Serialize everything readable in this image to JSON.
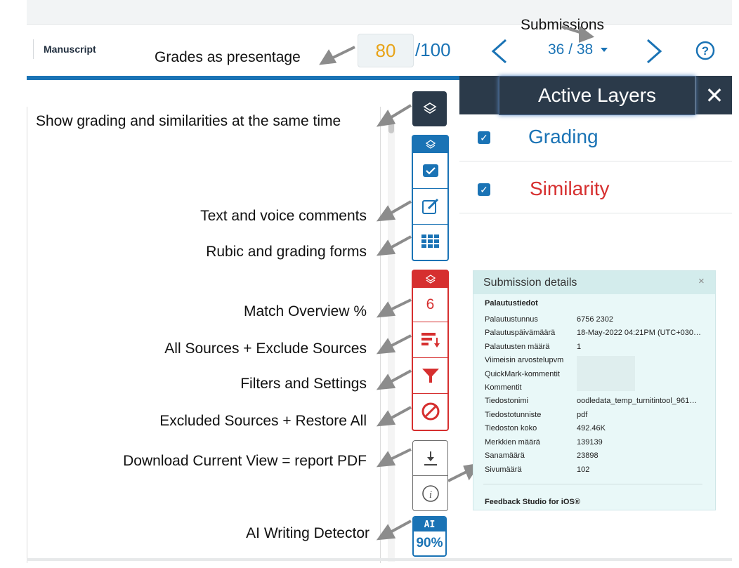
{
  "header": {
    "manuscript_label": "Manuscript",
    "grade_value": "80",
    "grade_total": "/100",
    "submission_count": "36 / 38"
  },
  "annotations": {
    "submissions": "Submissions",
    "grades": "Grades as presentage",
    "layers": "Show grading and similarities at the same time",
    "comments": "Text and voice comments",
    "rubric": "Rubic and grading forms",
    "match": "Match Overview %",
    "sources": "All Sources + Exclude Sources",
    "filters": "Filters and Settings",
    "excluded": "Excluded Sources + Restore All",
    "download": "Download Current View = report PDF",
    "ai": "AI Writing Detector"
  },
  "layers_panel": {
    "title": "Active Layers",
    "close": "✕",
    "items": [
      {
        "label": "Grading",
        "checked": true,
        "color": "#1a73b5"
      },
      {
        "label": "Similarity",
        "checked": true,
        "color": "#d62f2f"
      }
    ]
  },
  "toolbar": {
    "match_count": "6",
    "ai_label": "AI",
    "ai_percent": "90%"
  },
  "submission_details": {
    "title": "Submission details",
    "close": "×",
    "section": "Palautustiedot",
    "rows": [
      {
        "label": "Palautustunnus",
        "value": "6756  2302"
      },
      {
        "label": "Palautuspäivämäärä",
        "value": "18-May-2022 04:21PM (UTC+030…"
      },
      {
        "label": "Palautusten määrä",
        "value": "1"
      },
      {
        "label": "Viimeisin arvostelupvm",
        "value": ""
      },
      {
        "label": "QuickMark-kommentit",
        "value": ""
      },
      {
        "label": "Kommentit",
        "value": ""
      },
      {
        "label": "Tiedostonimi",
        "value": "oodledata_temp_turnitintool_961…"
      },
      {
        "label": "Tiedostotunniste",
        "value": "pdf"
      },
      {
        "label": "Tiedoston koko",
        "value": "492.46K"
      },
      {
        "label": "Merkkien määrä",
        "value": "139139"
      },
      {
        "label": "Sanamäärä",
        "value": "23898"
      },
      {
        "label": "Sivumäärä",
        "value": "102"
      }
    ],
    "footer": "Feedback Studio for iOS®"
  },
  "colors": {
    "accent": "#1a73b5",
    "similarity": "#d62f2f",
    "grade": "#e8a317",
    "panel_header": "#2b3a4a"
  }
}
